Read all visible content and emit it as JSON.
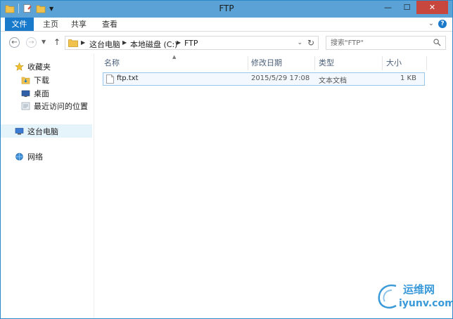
{
  "window": {
    "title": "FTP"
  },
  "ribbon": {
    "tabs": [
      {
        "label": "文件"
      },
      {
        "label": "主页"
      },
      {
        "label": "共享"
      },
      {
        "label": "查看"
      }
    ]
  },
  "address": {
    "crumbs": [
      "这台电脑",
      "本地磁盘 (C:)",
      "FTP"
    ]
  },
  "search": {
    "placeholder": "搜索\"FTP\""
  },
  "nav": {
    "favorites": "收藏夹",
    "downloads": "下载",
    "desktop": "桌面",
    "recent": "最近访问的位置",
    "this_pc": "这台电脑",
    "network": "网络"
  },
  "columns": {
    "name": "名称",
    "modified": "修改日期",
    "type": "类型",
    "size": "大小"
  },
  "files": [
    {
      "name": "ftp.txt",
      "modified": "2015/5/29 17:08",
      "type": "文本文档",
      "size": "1 KB"
    }
  ],
  "watermark": {
    "line1": "运维网",
    "line2": "iyunv.com"
  },
  "colors": {
    "accent": "#1979ca",
    "titlebar": "#5ba3d6",
    "close": "#c7463e",
    "selected_row": "#f2f8fd"
  }
}
